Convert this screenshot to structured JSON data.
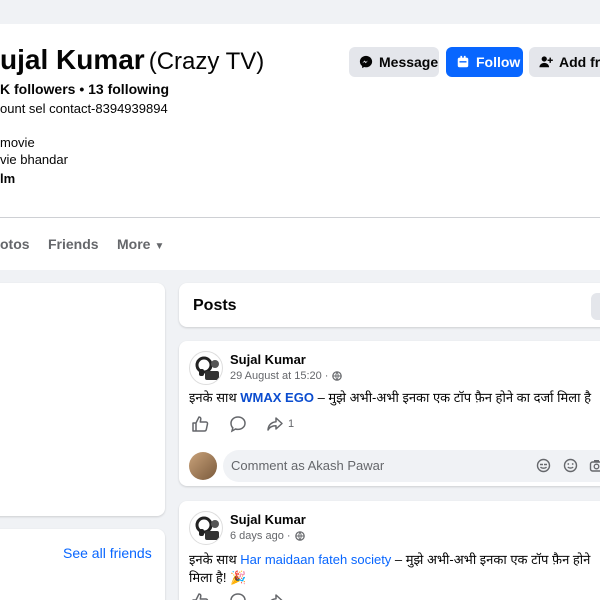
{
  "profile": {
    "name": "ujal Kumar",
    "nickname": "(Crazy TV)",
    "stats": "K followers • 13 following",
    "bio_contact": "ount sel contact-8394939894",
    "bio_line1": "movie",
    "bio_line2": "vie bhandar",
    "bio_line3": "lm"
  },
  "actions": {
    "message": "Message",
    "follow": "Follow",
    "add_friend": "Add frie"
  },
  "tabs": {
    "photos": "otos",
    "friends": "Friends",
    "more": "More"
  },
  "friends_card": {
    "see_all": "See all friends"
  },
  "posts_section": {
    "title": "Posts"
  },
  "posts": [
    {
      "author": "Sujal Kumar",
      "time": "29 August at 15:20 ·",
      "text_prefix": "इनके साथ ",
      "link": "WMAX EGO",
      "text_suffix": " – मुझे अभी-अभी इनका एक टॉप फ़ैन होने का दर्जा मिला है",
      "share_count": "1"
    },
    {
      "author": "Sujal Kumar",
      "time": "6 days ago ·",
      "text_prefix": "इनके साथ ",
      "link": "Har maidaan fateh society",
      "text_suffix": " – मुझे अभी-अभी इनका एक टॉप फ़ैन होने",
      "text_line2": "मिला है! 🎉"
    }
  ],
  "comment": {
    "placeholder": "Comment as Akash Pawar"
  },
  "colors": {
    "brand_blue": "#0866ff",
    "link_dark": "#0a4ccf",
    "page_bg": "#f0f2f5",
    "secondary_text": "#65676b"
  },
  "icons": {
    "message": "messenger-icon",
    "follow": "follow-icon",
    "add_friend": "add-friend-icon",
    "more": "caret-down-icon",
    "like": "like-icon",
    "comment": "comment-icon",
    "share": "share-icon",
    "globe": "globe-icon",
    "sticker": "sticker-icon",
    "emoji": "emoji-icon",
    "camera": "camera-icon"
  }
}
